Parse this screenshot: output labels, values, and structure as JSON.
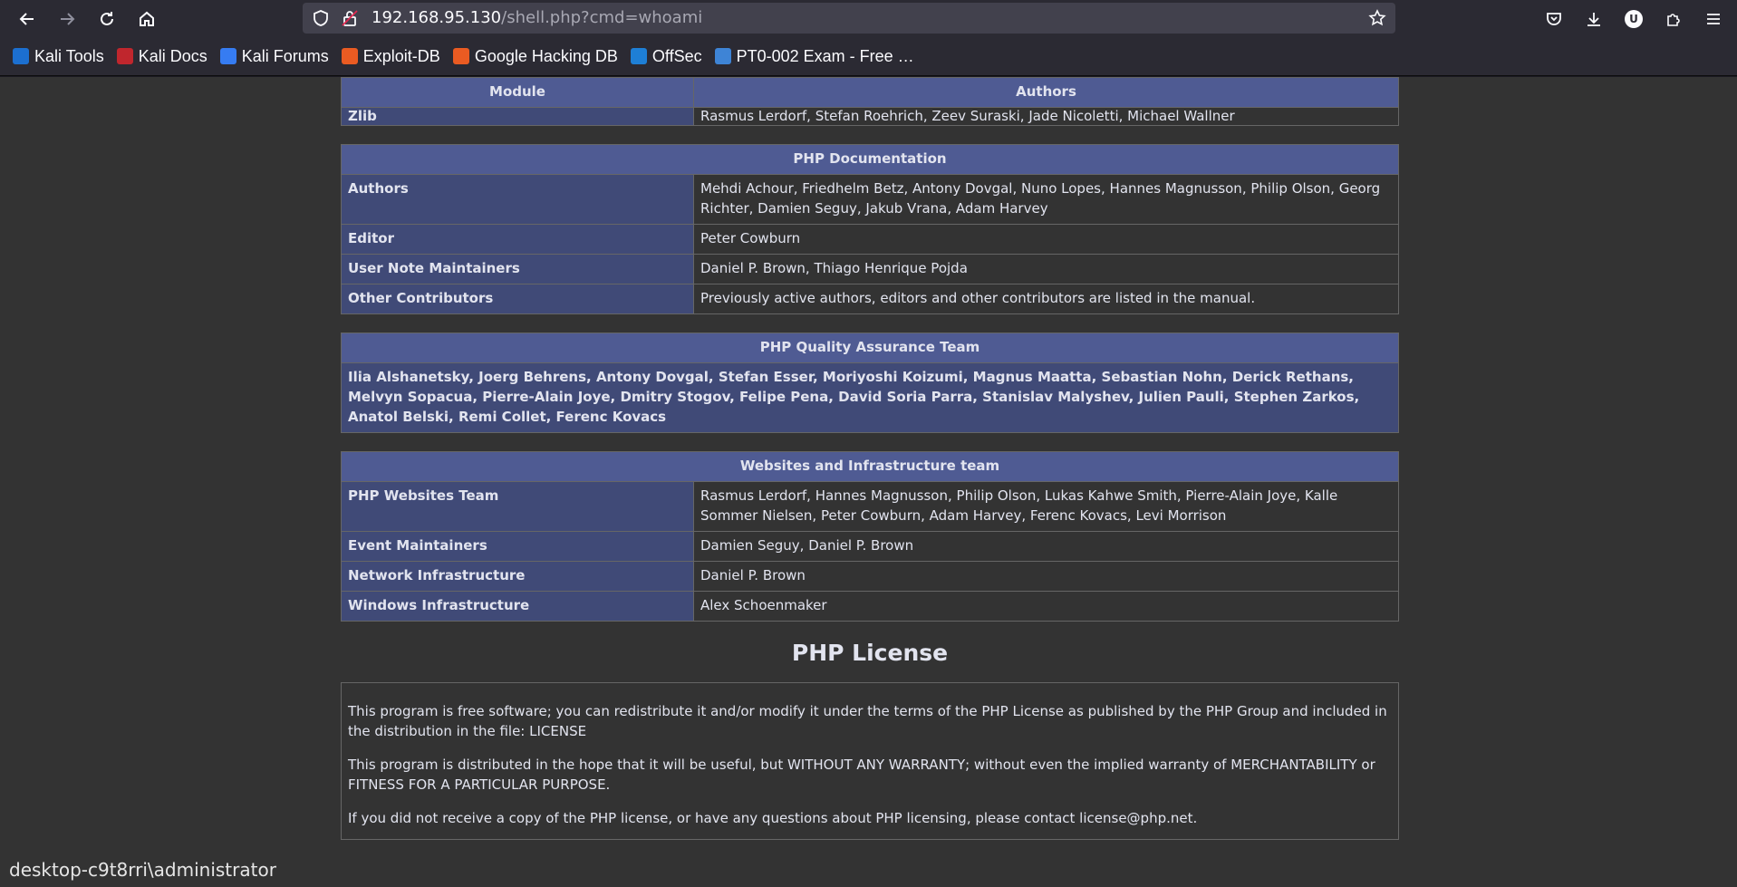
{
  "browser": {
    "url_host": "192.168.95.130",
    "url_path": "/shell.php?cmd=whoami",
    "bookmarks": [
      {
        "label": "Kali Tools",
        "color": "#1c6fd0"
      },
      {
        "label": "Kali Docs",
        "color": "#c0262d"
      },
      {
        "label": "Kali Forums",
        "color": "#367cf2"
      },
      {
        "label": "Exploit-DB",
        "color": "#ea5b22"
      },
      {
        "label": "Google Hacking DB",
        "color": "#ea5b22"
      },
      {
        "label": "OffSec",
        "color": "#1e7fd6"
      },
      {
        "label": "PT0-002 Exam - Free …",
        "color": "#3e84d6"
      }
    ],
    "avatar_letter": "U"
  },
  "module_table": {
    "header_module": "Module",
    "header_authors": "Authors",
    "row": {
      "name": "Zlib",
      "value": "Rasmus Lerdorf, Stefan Roehrich, Zeev Suraski, Jade Nicoletti, Michael Wallner"
    }
  },
  "doc_table": {
    "title": "PHP Documentation",
    "rows": [
      {
        "name": "Authors",
        "value": "Mehdi Achour, Friedhelm Betz, Antony Dovgal, Nuno Lopes, Hannes Magnusson, Philip Olson, Georg Richter, Damien Seguy, Jakub Vrana, Adam Harvey"
      },
      {
        "name": "Editor",
        "value": "Peter Cowburn"
      },
      {
        "name": "User Note Maintainers",
        "value": "Daniel P. Brown, Thiago Henrique Pojda"
      },
      {
        "name": "Other Contributors",
        "value": "Previously active authors, editors and other contributors are listed in the manual."
      }
    ]
  },
  "qa_table": {
    "title": "PHP Quality Assurance Team",
    "members": "Ilia Alshanetsky, Joerg Behrens, Antony Dovgal, Stefan Esser, Moriyoshi Koizumi, Magnus Maatta, Sebastian Nohn, Derick Rethans, Melvyn Sopacua, Pierre-Alain Joye, Dmitry Stogov, Felipe Pena, David Soria Parra, Stanislav Malyshev, Julien Pauli, Stephen Zarkos, Anatol Belski, Remi Collet, Ferenc Kovacs"
  },
  "web_table": {
    "title": "Websites and Infrastructure team",
    "rows": [
      {
        "name": "PHP Websites Team",
        "value": "Rasmus Lerdorf, Hannes Magnusson, Philip Olson, Lukas Kahwe Smith, Pierre-Alain Joye, Kalle Sommer Nielsen, Peter Cowburn, Adam Harvey, Ferenc Kovacs, Levi Morrison"
      },
      {
        "name": "Event Maintainers",
        "value": "Damien Seguy, Daniel P. Brown"
      },
      {
        "name": "Network Infrastructure",
        "value": "Daniel P. Brown"
      },
      {
        "name": "Windows Infrastructure",
        "value": "Alex Schoenmaker"
      }
    ]
  },
  "license": {
    "heading": "PHP License",
    "p1": "This program is free software; you can redistribute it and/or modify it under the terms of the PHP License as published by the PHP Group and included in the distribution in the file: LICENSE",
    "p2": "This program is distributed in the hope that it will be useful, but WITHOUT ANY WARRANTY; without even the implied warranty of MERCHANTABILITY or FITNESS FOR A PARTICULAR PURPOSE.",
    "p3": "If you did not receive a copy of the PHP license, or have any questions about PHP licensing, please contact license@php.net."
  },
  "command_output": "desktop-c9t8rri\\administrator"
}
